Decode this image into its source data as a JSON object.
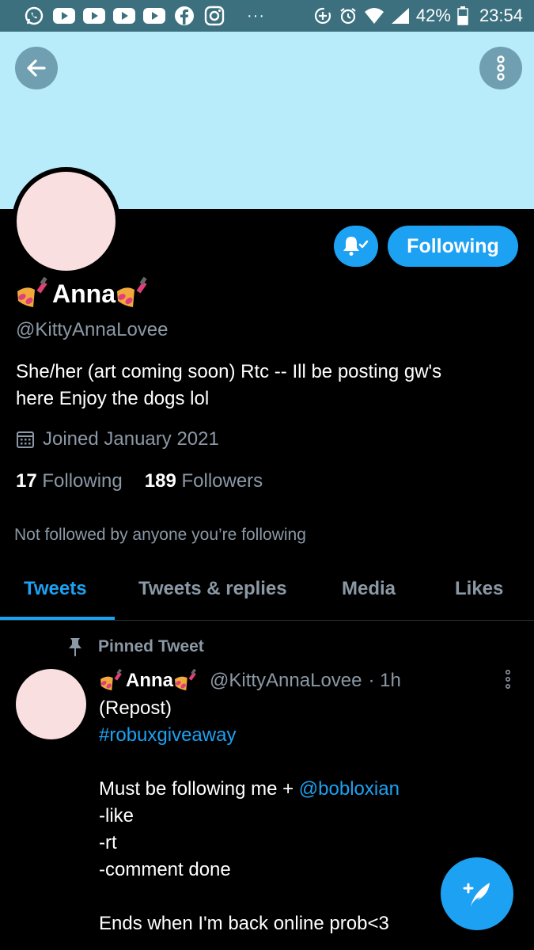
{
  "status_bar": {
    "battery": "42%",
    "time": "23:54",
    "left_icons": [
      "whatsapp-icon",
      "youtube-icon",
      "youtube-icon",
      "youtube-icon",
      "youtube-icon",
      "facebook-icon",
      "instagram-icon"
    ],
    "overflow": "···"
  },
  "header": {
    "back_icon": "arrow-left-icon",
    "more_icon": "more-vertical-icon"
  },
  "banner_color": "#b9ecfb",
  "profile": {
    "name": "Anna",
    "handle": "@KittyAnnaLovee",
    "bio_line1": "She/her (art coming soon)  Rtc -- Ill be posting gw's",
    "bio_line2": "here Enjoy the dogs lol",
    "joined": "Joined January 2021",
    "following_count": "17",
    "following_label": "Following",
    "followers_count": "189",
    "followers_label": "Followers",
    "not_followed": "Not followed by anyone you’re following",
    "follow_button": "Following",
    "avatar_color": "#f9dfe0"
  },
  "tabs": [
    {
      "label": "Tweets",
      "active": true
    },
    {
      "label": "Tweets & replies",
      "active": false
    },
    {
      "label": "Media",
      "active": false
    },
    {
      "label": "Likes",
      "active": false
    }
  ],
  "tweet": {
    "pinned_label": "Pinned Tweet",
    "name": "Anna",
    "handle": "@KittyAnnaLovee",
    "time": "· 1h",
    "line1": "(Repost)",
    "hashtag": "#robuxgiveaway",
    "line3_text": "Must be following me + ",
    "line3_mention": "@bobloxian",
    "line4": "-like",
    "line5": "-rt",
    "line6": "-comment done",
    "line7": "Ends when I'm back online prob<3"
  },
  "accent_color": "#1da1f2"
}
